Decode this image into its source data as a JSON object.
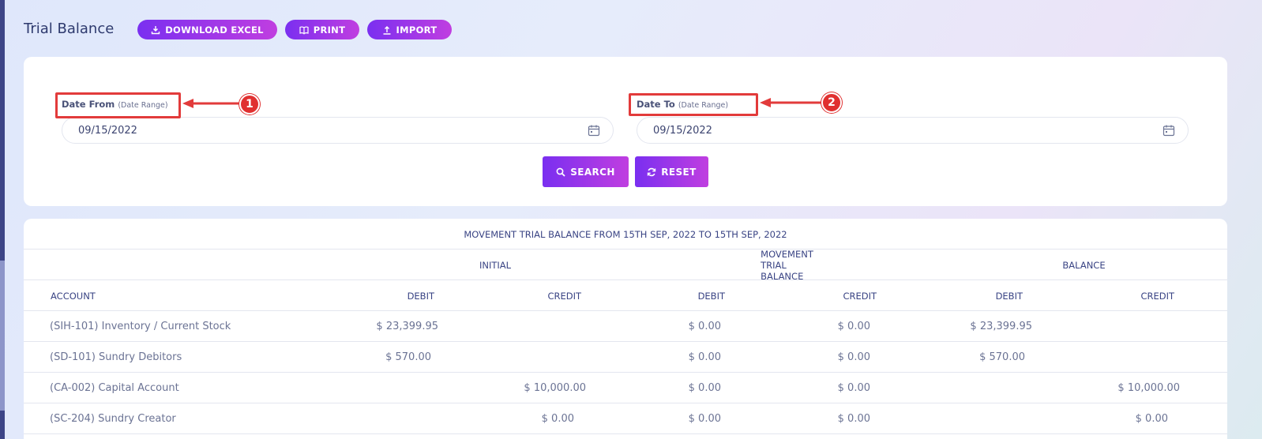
{
  "header": {
    "title": "Trial Balance",
    "buttons": [
      {
        "label": "DOWNLOAD EXCEL",
        "icon": "download-icon"
      },
      {
        "label": "PRINT",
        "icon": "book-icon"
      },
      {
        "label": "IMPORT",
        "icon": "upload-icon"
      }
    ]
  },
  "filters": {
    "date_from": {
      "label": "Date From",
      "sub": "(Date Range)",
      "value": "09/15/2022"
    },
    "date_to": {
      "label": "Date To",
      "sub": "(Date Range)",
      "value": "09/15/2022"
    },
    "search_label": "SEARCH",
    "reset_label": "RESET"
  },
  "annotations": {
    "badge_1": "1",
    "badge_2": "2",
    "color": "#e23b3b"
  },
  "table": {
    "caption": "MOVEMENT TRIAL BALANCE FROM 15TH SEP, 2022 TO 15TH SEP, 2022",
    "groups": {
      "initial": "INITIAL",
      "movement": "MOVEMENT TRIAL BALANCE",
      "balance": "BALANCE"
    },
    "columns": [
      "ACCOUNT",
      "DEBIT",
      "CREDIT",
      "DEBIT",
      "CREDIT",
      "DEBIT",
      "CREDIT"
    ],
    "rows": [
      [
        "(SIH-101) Inventory / Current Stock",
        "$ 23,399.95",
        "",
        "$ 0.00",
        "$ 0.00",
        "$ 23,399.95",
        ""
      ],
      [
        "(SD-101) Sundry Debitors",
        "$ 570.00",
        "",
        "$ 0.00",
        "$ 0.00",
        "$ 570.00",
        ""
      ],
      [
        "(CA-002) Capital Account",
        "",
        "$ 10,000.00",
        "$ 0.00",
        "$ 0.00",
        "",
        "$ 10,000.00"
      ],
      [
        "(SC-204) Sundry Creator",
        "",
        "$ 0.00",
        "$ 0.00",
        "$ 0.00",
        "",
        "$ 0.00"
      ]
    ]
  },
  "colors": {
    "accent_start": "#7a2ff0",
    "accent_end": "#c03ee0",
    "text_header": "#3a4484"
  }
}
